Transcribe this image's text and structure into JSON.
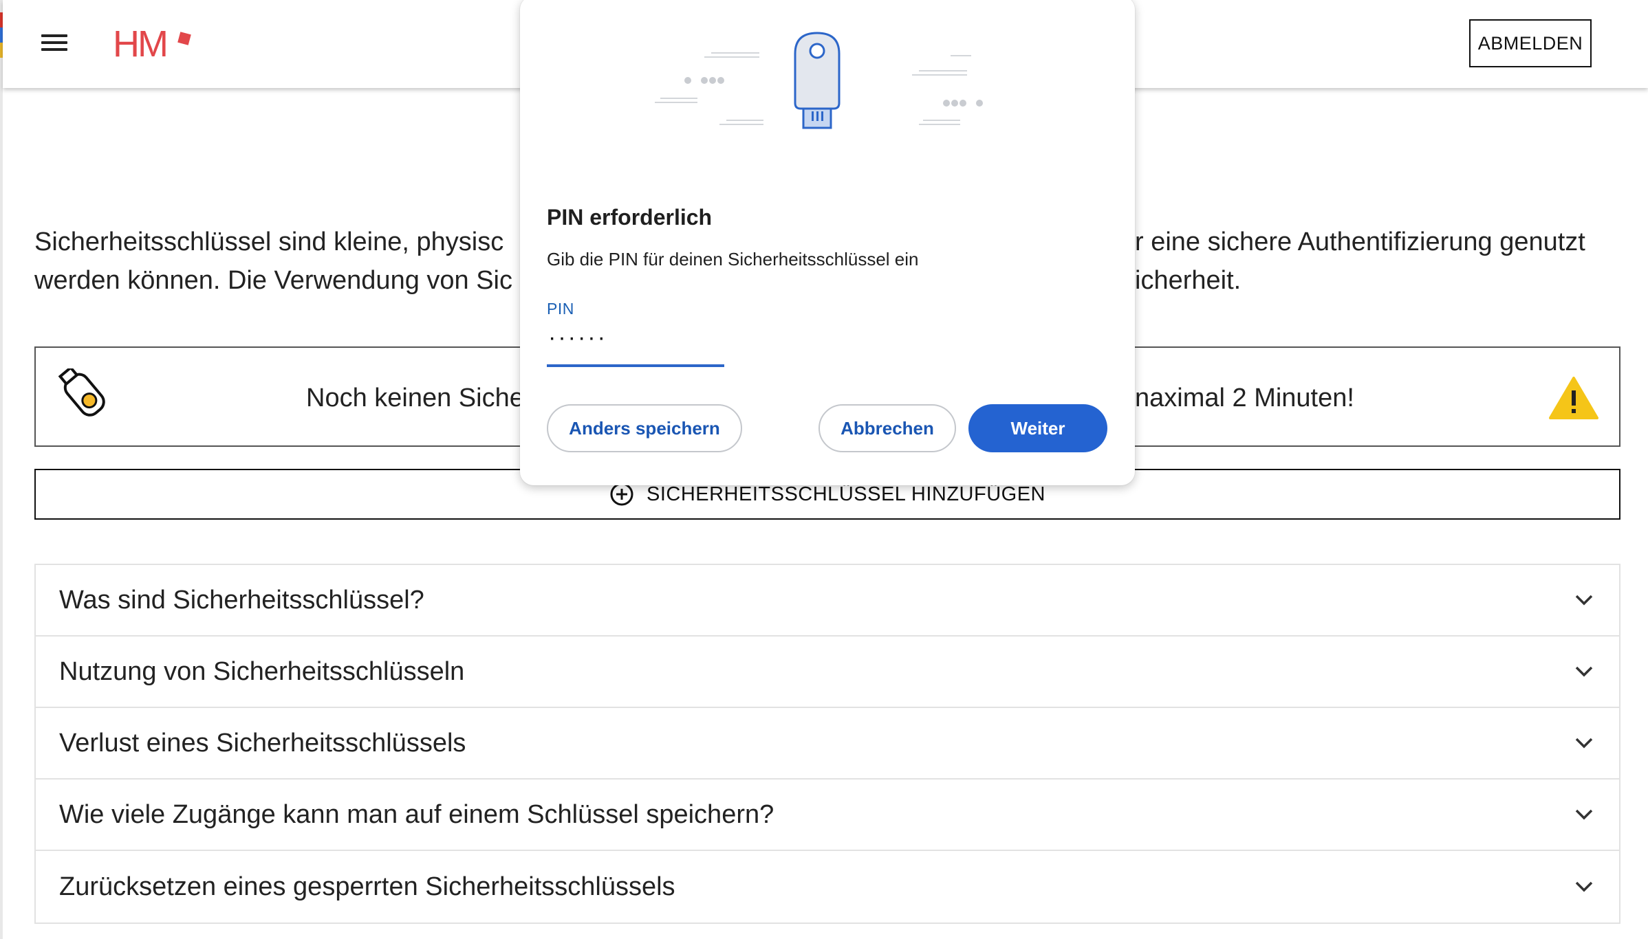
{
  "header": {
    "logo_text": "HM",
    "logout_label": "ABMELDEN"
  },
  "intro": {
    "line1_left": "Sicherheitsschlüssel sind kleine, physisc",
    "line1_right": "r eine sichere Authentifizierung genutzt",
    "line2_left": "werden können. Die Verwendung von Sic",
    "line2_right": "icherheit."
  },
  "notice": {
    "text_left": "Noch keinen Siche",
    "text_right": "naximal 2 Minuten!"
  },
  "add_key_label": "SICHERHEITSSCHLÜSSEL HINZUFÜGEN",
  "faq": [
    {
      "title": "Was sind Sicherheitsschlüssel?"
    },
    {
      "title": "Nutzung von Sicherheitsschlüsseln"
    },
    {
      "title": "Verlust eines Sicherheitsschlüssels"
    },
    {
      "title": "Wie viele Zugänge kann man auf einem Schlüssel speichern?"
    },
    {
      "title": "Zurücksetzen eines gesperrten Sicherheitsschlüssels"
    }
  ],
  "dialog": {
    "title": "PIN erforderlich",
    "subtitle": "Gib die PIN für deinen Sicherheitsschlüssel ein",
    "pin_label": "PIN",
    "pin_value": "······",
    "save_other_label": "Anders speichern",
    "cancel_label": "Abbrechen",
    "next_label": "Weiter"
  },
  "colors": {
    "accent": "#2463d1",
    "brand": "#e2474a",
    "warning": "#f5c518"
  }
}
